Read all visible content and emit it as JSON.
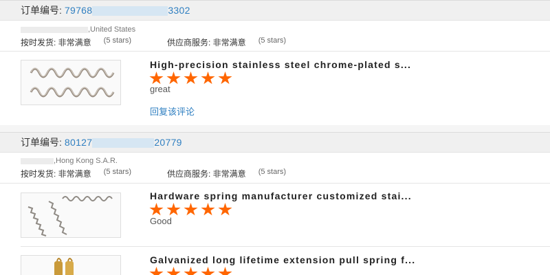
{
  "orders": [
    {
      "label": "订单编号:",
      "num_prefix": "79768",
      "num_suffix": "3302",
      "location": ",United States",
      "delivery_label": "按时发货: 非常满意",
      "delivery_stars": "(5 stars)",
      "service_label": "供应商服务: 非常满意",
      "service_stars": "(5 stars)",
      "items": [
        {
          "title": "High-precision stainless steel chrome-plated s...",
          "rating": 5,
          "comment": "great",
          "reply_label": "回复该评论"
        }
      ]
    },
    {
      "label": "订单编号:",
      "num_prefix": "80127",
      "num_suffix": "20779",
      "location": ",Hong Kong S.A.R.",
      "delivery_label": "按时发货: 非常满意",
      "delivery_stars": "(5 stars)",
      "service_label": "供应商服务: 非常满意",
      "service_stars": "(5 stars)",
      "items": [
        {
          "title": "Hardware spring manufacturer customized stai...",
          "rating": 5,
          "comment": "Good"
        },
        {
          "title": "Galvanized long lifetime extension pull spring f...",
          "rating": 5
        }
      ]
    }
  ],
  "colors": {
    "link": "#2f7fc1",
    "star": "#ff6600",
    "header_bg": "#f0f0f0"
  },
  "icons": [
    "star-icon"
  ]
}
